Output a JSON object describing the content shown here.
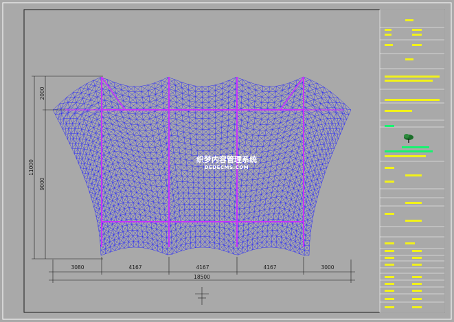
{
  "drawing": {
    "dimensions": {
      "overall_height": "11000",
      "top_height": "2000",
      "main_height": "9000",
      "overall_width": "18500",
      "bays": [
        "3080",
        "4167",
        "4167",
        "4167",
        "3000"
      ]
    },
    "watermark": {
      "chinese": "织梦内容管理系统",
      "english": "DEDECMS.COM"
    },
    "colors": {
      "background": "#a9a9a9",
      "frame": "#1a1a1a",
      "mesh": "#1f1fff",
      "beam": "#c832ff",
      "title_block_text": "#ffff00",
      "title_block_text_alt": "#00ff66"
    },
    "title_block": {
      "company_icon": "tree-logo-icon"
    }
  }
}
